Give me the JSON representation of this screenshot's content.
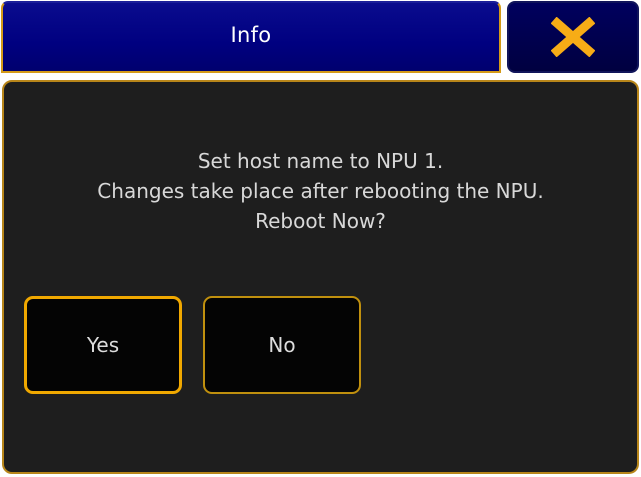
{
  "dialog": {
    "title": "Info",
    "close_icon": "close-x-icon",
    "message_lines": [
      "Set host name to NPU 1.",
      "Changes take place after rebooting the NPU.",
      "Reboot Now?"
    ],
    "buttons": {
      "yes_label": "Yes",
      "no_label": "No"
    }
  },
  "colors": {
    "title_bar": "#000080",
    "accent": "#f0a800",
    "panel_background": "#1e1e1e",
    "text": "#d8d8d8"
  }
}
